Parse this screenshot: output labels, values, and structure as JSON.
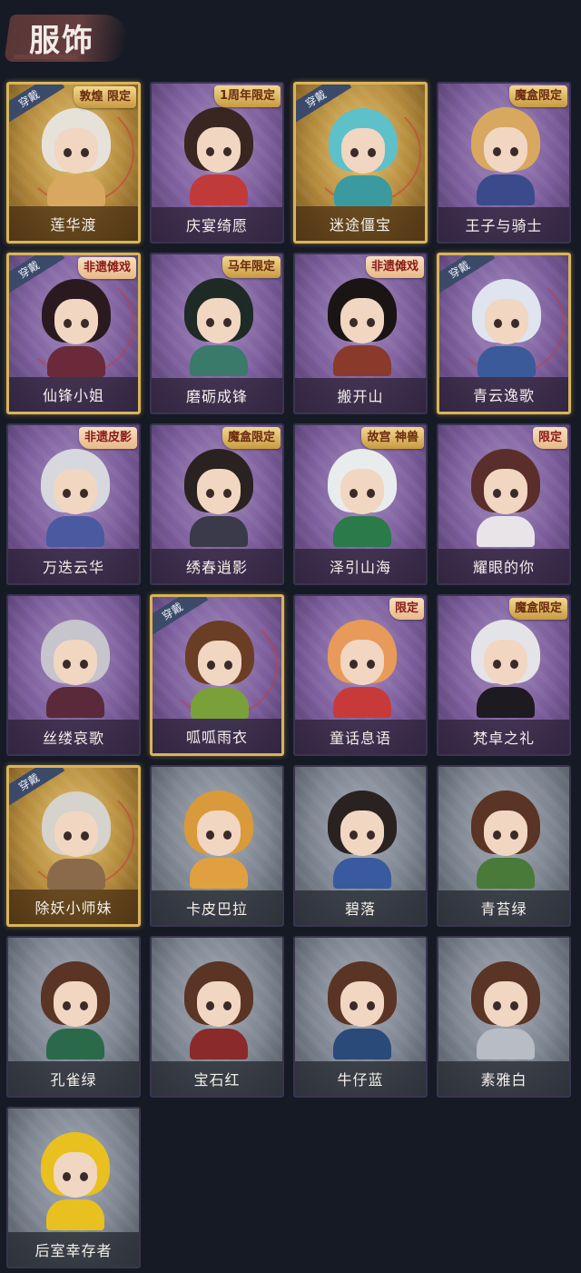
{
  "header": {
    "title": "服饰"
  },
  "costumes": [
    {
      "name": "莲华渡",
      "rarity": "gold",
      "equipped": true,
      "badge": "敦煌 限定",
      "badge_style": "gold",
      "hair": "#e6e2da",
      "outfit": "#d8a860"
    },
    {
      "name": "庆宴绮愿",
      "rarity": "purple",
      "equipped": false,
      "badge": "1周年限定",
      "badge_style": "gold",
      "hair": "#3a2620",
      "outfit": "#c03a3a"
    },
    {
      "name": "迷途僵宝",
      "rarity": "gold",
      "equipped": true,
      "badge": "",
      "badge_style": "",
      "hair": "#5ec0c8",
      "outfit": "#3a9aa0"
    },
    {
      "name": "王子与骑士",
      "rarity": "purple",
      "equipped": false,
      "badge": "魔盒限定",
      "badge_style": "gold",
      "hair": "#d8a860",
      "outfit": "#3a4a8a"
    },
    {
      "name": "仙锋小姐",
      "rarity": "purple",
      "equipped": true,
      "badge": "非遗傩戏",
      "badge_style": "red",
      "hair": "#2a1a20",
      "outfit": "#6a2a3a"
    },
    {
      "name": "磨砺成锋",
      "rarity": "purple",
      "equipped": false,
      "badge": "马年限定",
      "badge_style": "gold",
      "hair": "#1e2a26",
      "outfit": "#3a7a6a"
    },
    {
      "name": "搬开山",
      "rarity": "purple",
      "equipped": false,
      "badge": "非遗傩戏",
      "badge_style": "red",
      "hair": "#1a1414",
      "outfit": "#8a3a2a"
    },
    {
      "name": "青云逸歌",
      "rarity": "purple",
      "equipped": true,
      "badge": "",
      "badge_style": "",
      "hair": "#dfe4ee",
      "outfit": "#3a5a9a"
    },
    {
      "name": "万迭云华",
      "rarity": "purple",
      "equipped": false,
      "badge": "非遗皮影",
      "badge_style": "red",
      "hair": "#d6d8de",
      "outfit": "#4a5aa0"
    },
    {
      "name": "绣春逍影",
      "rarity": "purple",
      "equipped": false,
      "badge": "魔盒限定",
      "badge_style": "gold",
      "hair": "#2a2220",
      "outfit": "#3a3a4a"
    },
    {
      "name": "泽引山海",
      "rarity": "purple",
      "equipped": false,
      "badge": "故宫 神兽",
      "badge_style": "gold",
      "hair": "#e8ecec",
      "outfit": "#2a7a4a"
    },
    {
      "name": "耀眼的你",
      "rarity": "purple",
      "equipped": false,
      "badge": "限定",
      "badge_style": "red",
      "hair": "#5a2e2a",
      "outfit": "#e8e4e8"
    },
    {
      "name": "丝缕哀歌",
      "rarity": "purple",
      "equipped": false,
      "badge": "",
      "badge_style": "",
      "hair": "#c6c4cc",
      "outfit": "#5a2a3a"
    },
    {
      "name": "呱呱雨衣",
      "rarity": "purple",
      "equipped": true,
      "badge": "",
      "badge_style": "",
      "hair": "#6a3e24",
      "outfit": "#7aa03a"
    },
    {
      "name": "童话息语",
      "rarity": "purple",
      "equipped": false,
      "badge": "限定",
      "badge_style": "red",
      "hair": "#e89a5a",
      "outfit": "#c83a3a"
    },
    {
      "name": "梵卓之礼",
      "rarity": "purple",
      "equipped": false,
      "badge": "魔盒限定",
      "badge_style": "gold",
      "hair": "#e4e4e8",
      "outfit": "#1e1a22"
    },
    {
      "name": "除妖小师妹",
      "rarity": "gold",
      "equipped": true,
      "badge": "",
      "badge_style": "",
      "hair": "#d6d2cc",
      "outfit": "#8a6a4a"
    },
    {
      "name": "卡皮巴拉",
      "rarity": "grey",
      "equipped": false,
      "badge": "",
      "badge_style": "",
      "hair": "#d89a3a",
      "outfit": "#e0a040"
    },
    {
      "name": "碧落",
      "rarity": "grey",
      "equipped": false,
      "badge": "",
      "badge_style": "",
      "hair": "#2a2220",
      "outfit": "#3a5aa0"
    },
    {
      "name": "青苔绿",
      "rarity": "grey",
      "equipped": false,
      "badge": "",
      "badge_style": "",
      "hair": "#5a3424",
      "outfit": "#4a7a3a"
    },
    {
      "name": "孔雀绿",
      "rarity": "grey",
      "equipped": false,
      "badge": "",
      "badge_style": "",
      "hair": "#5a3424",
      "outfit": "#2a6a4a"
    },
    {
      "name": "宝石红",
      "rarity": "grey",
      "equipped": false,
      "badge": "",
      "badge_style": "",
      "hair": "#5a3424",
      "outfit": "#8a2a2a"
    },
    {
      "name": "牛仔蓝",
      "rarity": "grey",
      "equipped": false,
      "badge": "",
      "badge_style": "",
      "hair": "#5a3424",
      "outfit": "#2a4a7a"
    },
    {
      "name": "素雅白",
      "rarity": "grey",
      "equipped": false,
      "badge": "",
      "badge_style": "",
      "hair": "#5a3424",
      "outfit": "#b8bcc4"
    },
    {
      "name": "后室幸存者",
      "rarity": "grey",
      "equipped": false,
      "badge": "",
      "badge_style": "",
      "hair": "#e8c020",
      "outfit": "#e8c020"
    }
  ],
  "equipped_label": "穿戴"
}
